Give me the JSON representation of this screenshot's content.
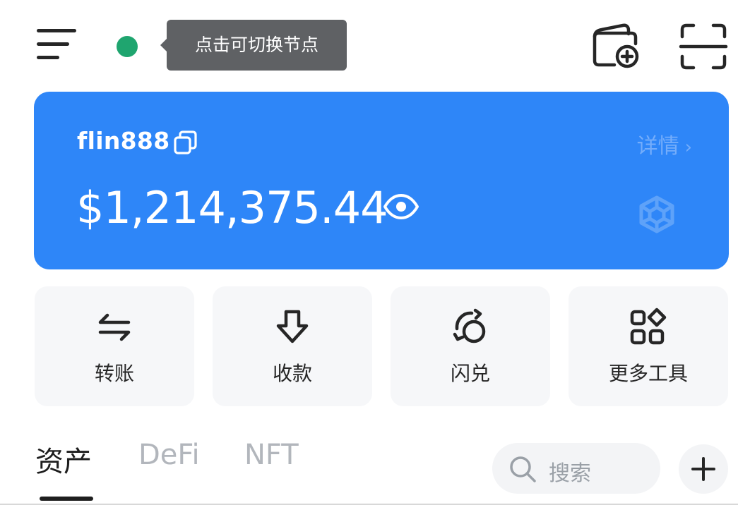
{
  "header": {
    "node_tooltip": "点击可切换节点",
    "node_status_color": "#1fa56f",
    "menu_icon": "hamburger-menu-icon",
    "wallet_add_icon": "wallet-add-icon",
    "scan_icon": "scan-icon"
  },
  "card": {
    "account_name": "flin888",
    "details_label": "详情",
    "balance": "$1,214,375.44",
    "accent_color": "#2e86f8"
  },
  "actions": [
    {
      "label": "转账",
      "icon": "transfer-icon"
    },
    {
      "label": "收款",
      "icon": "receive-icon"
    },
    {
      "label": "闪兑",
      "icon": "swap-icon"
    },
    {
      "label": "更多工具",
      "icon": "more-tools-icon"
    }
  ],
  "tabs": [
    {
      "label": "资产",
      "active": true
    },
    {
      "label": "DeFi",
      "active": false
    },
    {
      "label": "NFT",
      "active": false
    }
  ],
  "search": {
    "placeholder": "搜索"
  }
}
